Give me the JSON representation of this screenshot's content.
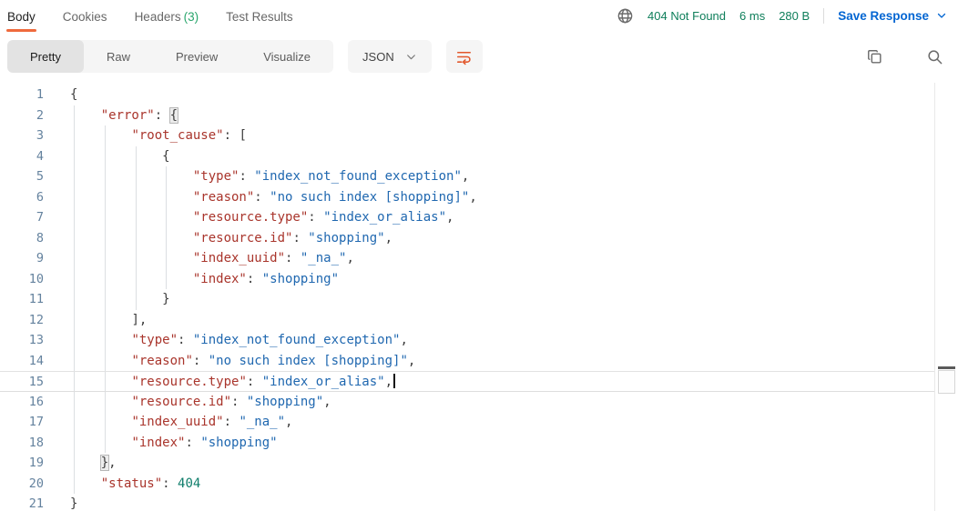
{
  "colors": {
    "accent_orange": "#ef6a3d",
    "accent_blue": "#0265d2",
    "green_status": "#0e7e5a",
    "green_count": "#29a56c",
    "icon_gray": "#6b6b6b",
    "wrap_icon_orange": "#e2572b",
    "tok_key": "#a9352c",
    "tok_str": "#2068b0",
    "tok_num": "#0f7e6b",
    "tok_punct": "#3d3d3d",
    "ln_color": "#64829e"
  },
  "response_tabs": {
    "items": [
      {
        "label": "Body",
        "active": true
      },
      {
        "label": "Cookies",
        "active": false
      },
      {
        "label": "Headers",
        "count": "(3)",
        "active": false
      },
      {
        "label": "Test Results",
        "active": false
      }
    ]
  },
  "response_meta": {
    "status": "404 Not Found",
    "time": "6 ms",
    "size": "280 B",
    "save_button": "Save Response"
  },
  "view_toolbar": {
    "modes": [
      "Pretty",
      "Raw",
      "Preview",
      "Visualize"
    ],
    "active_mode": "Pretty",
    "language": "JSON"
  },
  "editor": {
    "lines": [
      {
        "num": "1",
        "indent": 0,
        "tokens": [
          [
            "p",
            "{"
          ]
        ]
      },
      {
        "num": "2",
        "indent": 4,
        "tokens": [
          [
            "k",
            "\"error\""
          ],
          [
            "p",
            ": "
          ],
          [
            "b",
            "{"
          ]
        ]
      },
      {
        "num": "3",
        "indent": 8,
        "tokens": [
          [
            "k",
            "\"root_cause\""
          ],
          [
            "p",
            ": ["
          ]
        ]
      },
      {
        "num": "4",
        "indent": 12,
        "tokens": [
          [
            "p",
            "{"
          ]
        ]
      },
      {
        "num": "5",
        "indent": 16,
        "tokens": [
          [
            "k",
            "\"type\""
          ],
          [
            "p",
            ": "
          ],
          [
            "s",
            "\"index_not_found_exception\""
          ],
          [
            "p",
            ","
          ]
        ]
      },
      {
        "num": "6",
        "indent": 16,
        "tokens": [
          [
            "k",
            "\"reason\""
          ],
          [
            "p",
            ": "
          ],
          [
            "s",
            "\"no such index [shopping]\""
          ],
          [
            "p",
            ","
          ]
        ]
      },
      {
        "num": "7",
        "indent": 16,
        "tokens": [
          [
            "k",
            "\"resource.type\""
          ],
          [
            "p",
            ": "
          ],
          [
            "s",
            "\"index_or_alias\""
          ],
          [
            "p",
            ","
          ]
        ]
      },
      {
        "num": "8",
        "indent": 16,
        "tokens": [
          [
            "k",
            "\"resource.id\""
          ],
          [
            "p",
            ": "
          ],
          [
            "s",
            "\"shopping\""
          ],
          [
            "p",
            ","
          ]
        ]
      },
      {
        "num": "9",
        "indent": 16,
        "tokens": [
          [
            "k",
            "\"index_uuid\""
          ],
          [
            "p",
            ": "
          ],
          [
            "s",
            "\"_na_\""
          ],
          [
            "p",
            ","
          ]
        ]
      },
      {
        "num": "10",
        "indent": 16,
        "tokens": [
          [
            "k",
            "\"index\""
          ],
          [
            "p",
            ": "
          ],
          [
            "s",
            "\"shopping\""
          ]
        ]
      },
      {
        "num": "11",
        "indent": 12,
        "tokens": [
          [
            "p",
            "}"
          ]
        ]
      },
      {
        "num": "12",
        "indent": 8,
        "tokens": [
          [
            "p",
            "],"
          ]
        ]
      },
      {
        "num": "13",
        "indent": 8,
        "tokens": [
          [
            "k",
            "\"type\""
          ],
          [
            "p",
            ": "
          ],
          [
            "s",
            "\"index_not_found_exception\""
          ],
          [
            "p",
            ","
          ]
        ]
      },
      {
        "num": "14",
        "indent": 8,
        "tokens": [
          [
            "k",
            "\"reason\""
          ],
          [
            "p",
            ": "
          ],
          [
            "s",
            "\"no such index [shopping]\""
          ],
          [
            "p",
            ","
          ]
        ]
      },
      {
        "num": "15",
        "indent": 8,
        "tokens": [
          [
            "k",
            "\"resource.type\""
          ],
          [
            "p",
            ": "
          ],
          [
            "s",
            "\"index_or_alias\""
          ],
          [
            "p",
            ","
          ]
        ],
        "active": true,
        "caret": true
      },
      {
        "num": "16",
        "indent": 8,
        "tokens": [
          [
            "k",
            "\"resource.id\""
          ],
          [
            "p",
            ": "
          ],
          [
            "s",
            "\"shopping\""
          ],
          [
            "p",
            ","
          ]
        ]
      },
      {
        "num": "17",
        "indent": 8,
        "tokens": [
          [
            "k",
            "\"index_uuid\""
          ],
          [
            "p",
            ": "
          ],
          [
            "s",
            "\"_na_\""
          ],
          [
            "p",
            ","
          ]
        ]
      },
      {
        "num": "18",
        "indent": 8,
        "tokens": [
          [
            "k",
            "\"index\""
          ],
          [
            "p",
            ": "
          ],
          [
            "s",
            "\"shopping\""
          ]
        ]
      },
      {
        "num": "19",
        "indent": 4,
        "tokens": [
          [
            "b",
            "}"
          ],
          [
            "p",
            ","
          ]
        ]
      },
      {
        "num": "20",
        "indent": 4,
        "tokens": [
          [
            "k",
            "\"status\""
          ],
          [
            "p",
            ": "
          ],
          [
            "n",
            "404"
          ]
        ]
      },
      {
        "num": "21",
        "indent": 0,
        "tokens": [
          [
            "p",
            "}"
          ]
        ]
      }
    ]
  }
}
